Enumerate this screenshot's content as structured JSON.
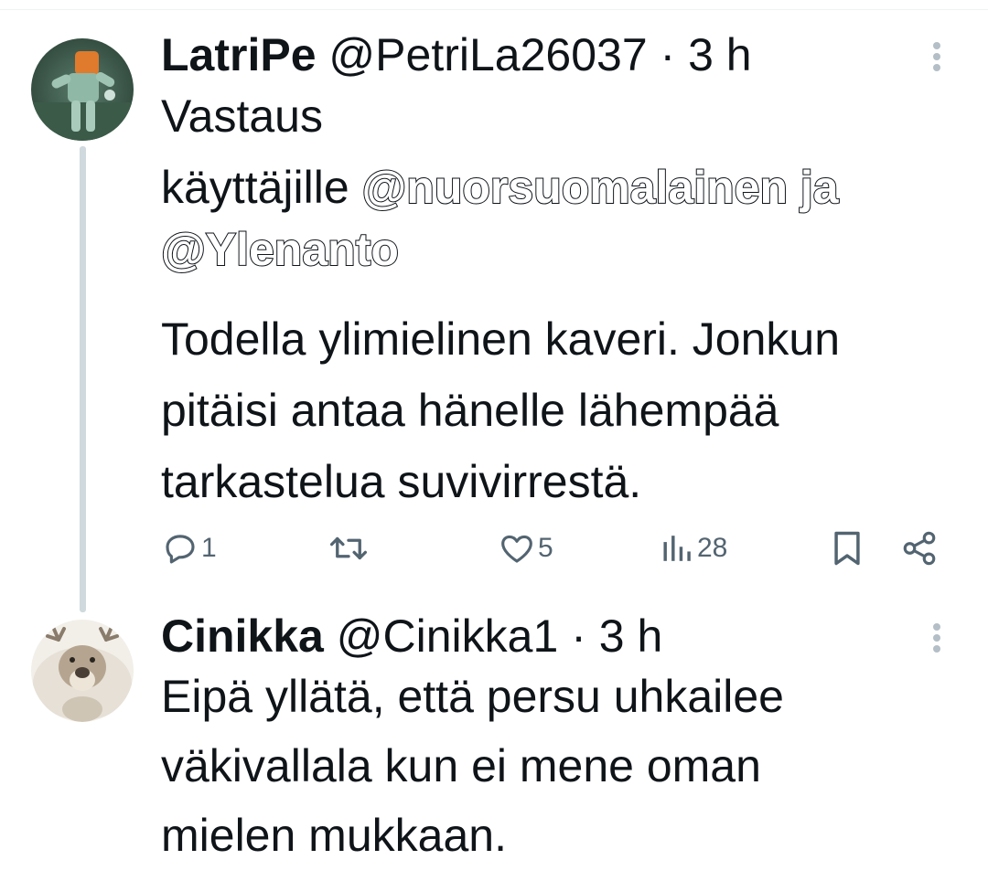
{
  "tweets": [
    {
      "name": "LatriPe",
      "handle": "@PetriLa26037",
      "dot": "·",
      "time": "3 h",
      "reply_prefix_line1": "Vastaus",
      "reply_prefix_line2": "käyttäjille",
      "mention1": "@nuorsuomalainen ja",
      "mention2": "@Ylenanto",
      "body_lines": [
        "Todella ylimielinen kaveri. Jonkun",
        "pitäisi antaa hänelle lähempää",
        "tarkastelua suvivirrestä."
      ],
      "actions": {
        "reply_count": "1",
        "retweet_count": "",
        "like_count": "5",
        "views_count": "28"
      },
      "avatar_icon": "avatar-robot-figure-icon"
    },
    {
      "name": "Cinikka",
      "handle": "@Cinikka1",
      "dot": "·",
      "time": "3 h",
      "body_lines": [
        "Eipä yllätä, että persu uhkailee",
        "väkivallala kun ei mene oman",
        "mielen mukkaan."
      ],
      "avatar_icon": "avatar-reindeer-icon"
    }
  ],
  "colors": {
    "text": "#0f1419",
    "secondary": "#536471",
    "thread_line": "#cfd9de",
    "more_dots": "#b4bec6"
  }
}
